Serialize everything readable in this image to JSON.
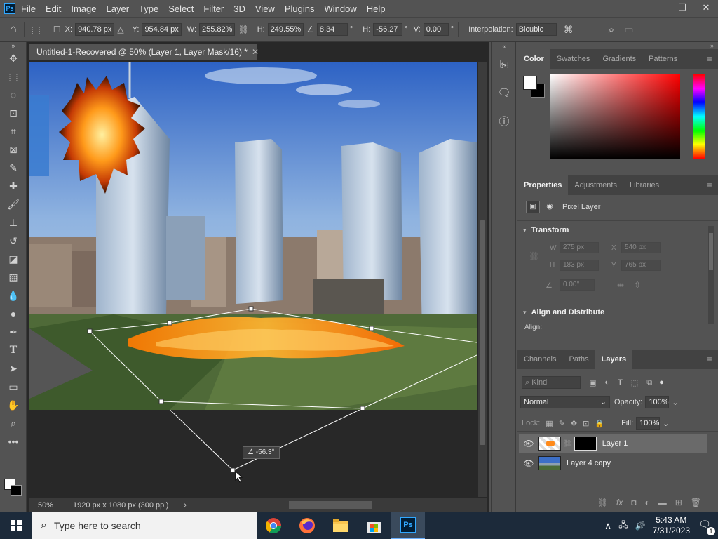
{
  "app": {
    "logo": "Ps",
    "menus": [
      "File",
      "Edit",
      "Image",
      "Layer",
      "Type",
      "Select",
      "Filter",
      "3D",
      "View",
      "Plugins",
      "Window",
      "Help"
    ],
    "window_buttons": {
      "minimize": "—",
      "restore": "❐",
      "close": "✕"
    }
  },
  "options": {
    "x_label": "X:",
    "x_value": "940.78 px",
    "y_label": "Y:",
    "y_value": "954.84 px",
    "w_label": "W:",
    "w_value": "255.82%",
    "h_label": "H:",
    "h_value": "249.55%",
    "angle_value": "8.34",
    "degree": "°",
    "hskew_label": "H:",
    "hskew_value": "-56.27",
    "vskew_label": "V:",
    "vskew_value": "0.00",
    "interp_label": "Interpolation:",
    "interp_value": "Bicubic"
  },
  "document": {
    "tab_title": "Untitled-1-Recovered @ 50% (Layer 1, Layer Mask/16) *",
    "close": "✕",
    "zoom": "50%",
    "dimensions": "1920 px x 1080 px (300 ppi)",
    "angle_tooltip": "-56.3°"
  },
  "color_panel": {
    "tabs": [
      "Color",
      "Swatches",
      "Gradients",
      "Patterns"
    ],
    "fg": "#ffffff",
    "bg": "#000000"
  },
  "properties_panel": {
    "tabs": [
      "Properties",
      "Adjustments",
      "Libraries"
    ],
    "kind": "Pixel Layer",
    "transform_title": "Transform",
    "w_label": "W",
    "w_value": "275 px",
    "x_label": "X",
    "x_value": "540 px",
    "h_label": "H",
    "h_value": "183 px",
    "y_label": "Y",
    "y_value": "765 px",
    "angle_value": "0.00°",
    "align_title": "Align and Distribute",
    "align_label": "Align:"
  },
  "layers_panel": {
    "tabs": [
      "Channels",
      "Paths",
      "Layers"
    ],
    "kind_placeholder": "Kind",
    "blend_mode": "Normal",
    "opacity_label": "Opacity:",
    "opacity_value": "100%",
    "lock_label": "Lock:",
    "fill_label": "Fill:",
    "fill_value": "100%",
    "layers": [
      {
        "name": "Layer 1",
        "selected": true
      },
      {
        "name": "Layer 4 copy",
        "selected": false
      }
    ]
  },
  "taskbar": {
    "search_placeholder": "Type here to search",
    "time": "5:43 AM",
    "date": "7/31/2023",
    "notification_count": "1"
  }
}
